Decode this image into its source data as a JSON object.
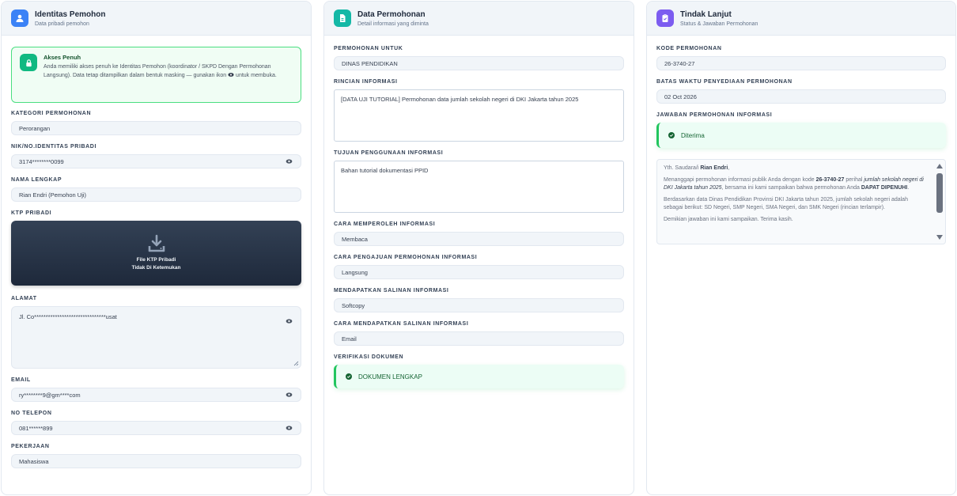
{
  "identitas": {
    "title": "Identitas Pemohon",
    "subtitle": "Data pribadi pemohon",
    "notice_title": "Akses Penuh",
    "notice_text_1": "Anda memiliki akses penuh ke Identitas Pemohon (koordinator / SKPD Dengan Permohonan Langsung). Data tetap ditampilkan dalam bentuk masking — gunakan ikon",
    "notice_text_2": "untuk membuka.",
    "kategori_label": "KATEGORI PERMOHONAN",
    "kategori_value": "Perorangan",
    "nik_label": "NIK/NO.IDENTITAS PRIBADI",
    "nik_value": "3174********0099",
    "nama_label": "NAMA LENGKAP",
    "nama_value": "Rian Endri (Pemohon Uji)",
    "ktp_label": "KTP PRIBADI",
    "ktp_line1": "File KTP Pribadi",
    "ktp_line2": "Tidak Di Ketemukan",
    "alamat_label": "ALAMAT",
    "alamat_value": "Jl. Co*******************************usat",
    "email_label": "EMAIL",
    "email_value": "ry********9@gm****com",
    "telepon_label": "NO TELEPON",
    "telepon_value": "081******899",
    "pekerjaan_label": "PEKERJAAN",
    "pekerjaan_value": "Mahasiswa"
  },
  "permohonan": {
    "title": "Data Permohonan",
    "subtitle": "Detail informasi yang diminta",
    "untuk_label": "PERMOHONAN UNTUK",
    "untuk_value": "DINAS PENDIDIKAN",
    "rincian_label": "RINCIAN INFORMASI",
    "rincian_value": "[DATA UJI TUTORIAL] Permohonan data jumlah sekolah negeri di DKI Jakarta tahun 2025",
    "tujuan_label": "TUJUAN PENGGUNAAN INFORMASI",
    "tujuan_value": "Bahan tutorial dokumentasi PPID",
    "cara_memperoleh_label": "CARA MEMPEROLEH INFORMASI",
    "cara_memperoleh_value": "Membaca",
    "cara_pengajuan_label": "CARA PENGAJUAN PERMOHONAN INFORMASI",
    "cara_pengajuan_value": "Langsung",
    "salinan_label": "MENDAPATKAN SALINAN INFORMASI",
    "salinan_value": "Softcopy",
    "cara_salinan_label": "CARA MENDAPATKAN SALINAN INFORMASI",
    "cara_salinan_value": "Email",
    "verifikasi_label": "VERIFIKASI DOKUMEN",
    "verifikasi_value": "DOKUMEN LENGKAP"
  },
  "tindak": {
    "title": "Tindak Lanjut",
    "subtitle": "Status & Jawaban Permohonan",
    "kode_label": "KODE PERMOHONAN",
    "kode_value": "26-3740-27",
    "batas_label": "BATAS WAKTU PENYEDIAAN PERMOHONAN",
    "batas_value": "02 Oct 2026",
    "jawaban_label": "JAWABAN PERMOHONAN INFORMASI",
    "jawaban_status": "Diterima",
    "reply": {
      "p1_a": "Yth. Saudara/i ",
      "p1_b": "Rian Endri",
      "p1_c": ",",
      "p2_a": "Menanggapi permohonan informasi publik Anda dengan kode ",
      "p2_b": "26-3740-27",
      "p2_c": " perihal ",
      "p2_d": "jumlah sekolah negeri di DKI Jakarta tahun 2025",
      "p2_e": ", bersama ini kami sampaikan bahwa permohonan Anda ",
      "p2_f": "DAPAT DIPENUHI",
      "p2_g": ".",
      "p3": "Berdasarkan data Dinas Pendidikan Provinsi DKI Jakarta tahun 2025, jumlah sekolah negeri adalah sebagai berikut: SD Negeri, SMP Negeri, SMA Negeri, dan SMK Negeri (rincian terlampir).",
      "p4": "Demikian jawaban ini kami sampaikan. Terima kasih."
    }
  },
  "colors": {
    "accent_blue": "#3b82f6",
    "accent_teal": "#14b8a6",
    "accent_purple": "#7c5cf0",
    "success": "#22c55e"
  }
}
